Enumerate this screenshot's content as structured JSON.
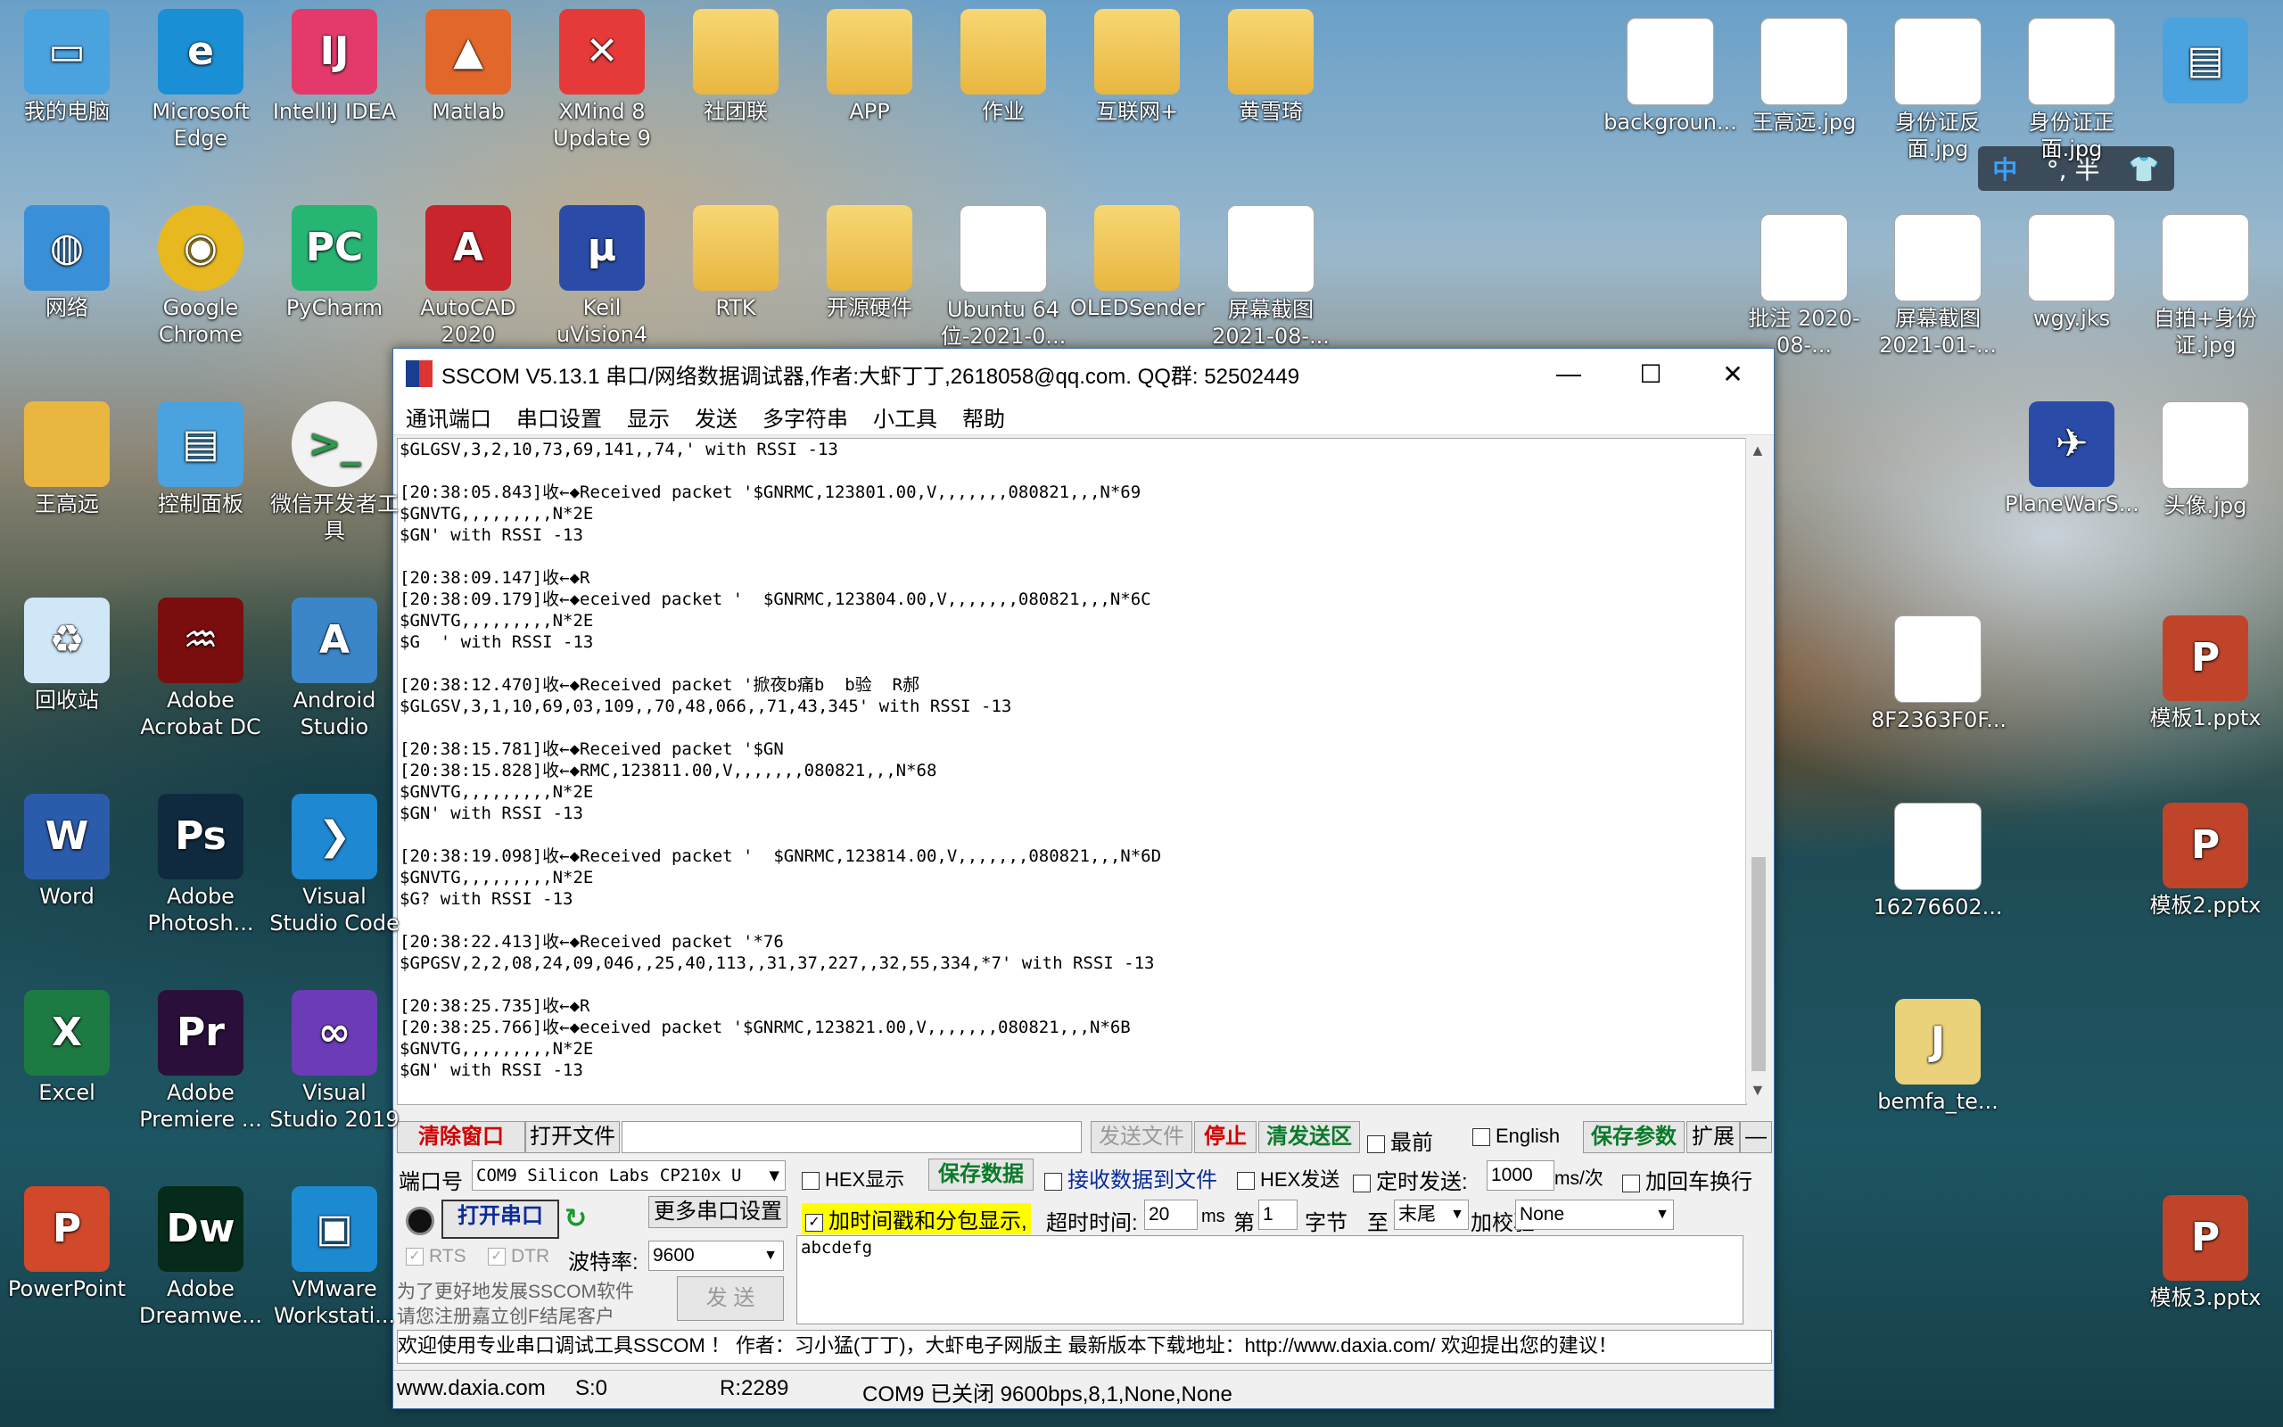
{
  "desktop_icons_left": [
    {
      "label": "我的电脑",
      "icon": "computer-icon"
    },
    {
      "label": "Microsoft Edge",
      "icon": "edge-icon"
    },
    {
      "label": "IntelliJ IDEA",
      "icon": "intellij-icon"
    },
    {
      "label": "Matlab",
      "icon": "matlab-icon"
    },
    {
      "label": "XMind 8 Update 9",
      "icon": "xmind-icon"
    },
    {
      "label": "社团联",
      "icon": "folder-icon"
    },
    {
      "label": "APP",
      "icon": "folder-icon"
    },
    {
      "label": "作业",
      "icon": "folder-icon"
    },
    {
      "label": "互联网+",
      "icon": "folder-icon"
    },
    {
      "label": "黄雪琦",
      "icon": "folder-icon"
    },
    {
      "label": "网络",
      "icon": "network-icon"
    },
    {
      "label": "Google Chrome",
      "icon": "chrome-icon"
    },
    {
      "label": "PyCharm",
      "icon": "pycharm-icon"
    },
    {
      "label": "AutoCAD 2020",
      "icon": "autocad-icon"
    },
    {
      "label": "Keil uVision4",
      "icon": "keil-icon"
    },
    {
      "label": "RTK",
      "icon": "folder-icon"
    },
    {
      "label": "开源硬件",
      "icon": "folder-icon"
    },
    {
      "label": "Ubuntu 64 位-2021-0...",
      "icon": "file-icon"
    },
    {
      "label": "OLEDSender",
      "icon": "folder-icon"
    },
    {
      "label": "屏幕截图 2021-08-...",
      "icon": "image-icon"
    },
    {
      "label": "王高远",
      "icon": "user-folder-icon"
    },
    {
      "label": "控制面板",
      "icon": "control-panel-icon"
    },
    {
      "label": "微信开发者工具",
      "icon": "wechat-dev-icon"
    },
    {
      "label": "回收站",
      "icon": "recycle-bin-icon"
    },
    {
      "label": "Adobe Acrobat DC",
      "icon": "acrobat-icon"
    },
    {
      "label": "Android Studio",
      "icon": "android-studio-icon"
    },
    {
      "label": "Word",
      "icon": "word-icon"
    },
    {
      "label": "Adobe Photosh...",
      "icon": "photoshop-icon"
    },
    {
      "label": "Visual Studio Code",
      "icon": "vscode-icon"
    },
    {
      "label": "Excel",
      "icon": "excel-icon"
    },
    {
      "label": "Adobe Premiere ...",
      "icon": "premiere-icon"
    },
    {
      "label": "Visual Studio 2019",
      "icon": "visual-studio-icon"
    },
    {
      "label": "PowerPoint",
      "icon": "powerpoint-icon"
    },
    {
      "label": "Adobe Dreamwe...",
      "icon": "dreamweaver-icon"
    },
    {
      "label": "VMware Workstati...",
      "icon": "vmware-icon"
    }
  ],
  "desktop_icons_right": [
    {
      "label": "backgroun...",
      "icon": "image-icon"
    },
    {
      "label": "王高远.jpg",
      "icon": "image-icon"
    },
    {
      "label": "身份证反面.jpg",
      "icon": "image-icon"
    },
    {
      "label": "身份证正面.jpg",
      "icon": "image-icon"
    },
    {
      "label": "",
      "icon": "control-panel-icon"
    },
    {
      "label": "批注 2020-08-...",
      "icon": "image-icon"
    },
    {
      "label": "屏幕截图 2021-01-...",
      "icon": "image-icon"
    },
    {
      "label": "wgy.jks",
      "icon": "file-icon"
    },
    {
      "label": "自拍+身份证.jpg",
      "icon": "image-icon"
    },
    {
      "label": "PlaneWarS...",
      "icon": "game-icon"
    },
    {
      "label": "头像.jpg",
      "icon": "image-icon"
    },
    {
      "label": "8F2363F0F...",
      "icon": "image-icon"
    },
    {
      "label": "模板1.pptx",
      "icon": "pptx-icon"
    },
    {
      "label": "16276602...",
      "icon": "image-icon"
    },
    {
      "label": "模板2.pptx",
      "icon": "pptx-icon"
    },
    {
      "label": "bemfa_te...",
      "icon": "archive-icon"
    },
    {
      "label": "模板3.pptx",
      "icon": "pptx-icon"
    }
  ],
  "ime": {
    "lang": "中",
    "punct": "°, 半",
    "skin": "shirt-icon"
  },
  "window": {
    "title": "SSCOM V5.13.1 串口/网络数据调试器,作者:大虾丁丁,2618058@qq.com. QQ群:  52502449",
    "minimize": "—",
    "maximize": "☐",
    "close": "✕",
    "menu": [
      "通讯端口",
      "串口设置",
      "显示",
      "发送",
      "多字符串",
      "小工具",
      "帮助"
    ]
  },
  "log_lines": [
    "$GLGSV,3,2,10,73,69,141,,74,' with RSSI -13",
    "",
    "[20:38:05.843]收←◆Received packet '$GNRMC,123801.00,V,,,,,,,080821,,,N*69",
    "$GNVTG,,,,,,,,,N*2E",
    "$GN' with RSSI -13",
    "",
    "[20:38:09.147]收←◆R",
    "[20:38:09.179]收←◆eceived packet '  $GNRMC,123804.00,V,,,,,,,080821,,,N*6C",
    "$GNVTG,,,,,,,,,N*2E",
    "$G  ' with RSSI -13",
    "",
    "[20:38:12.470]收←◆Received packet '掀夜b痛b  b验  R郝",
    "$GLGSV,3,1,10,69,03,109,,70,48,066,,71,43,345' with RSSI -13",
    "",
    "[20:38:15.781]收←◆Received packet '$GN",
    "[20:38:15.828]收←◆RMC,123811.00,V,,,,,,,080821,,,N*68",
    "$GNVTG,,,,,,,,,N*2E",
    "$GN' with RSSI -13",
    "",
    "[20:38:19.098]收←◆Received packet '  $GNRMC,123814.00,V,,,,,,,080821,,,N*6D",
    "$GNVTG,,,,,,,,,N*2E",
    "$G? with RSSI -13",
    "",
    "[20:38:22.413]收←◆Received packet '*76",
    "$GPGSV,2,2,08,24,09,046,,25,40,113,,31,37,227,,32,55,334,*7' with RSSI -13",
    "",
    "[20:38:25.735]收←◆R",
    "[20:38:25.766]收←◆eceived packet '$GNRMC,123821.00,V,,,,,,,080821,,,N*6B",
    "$GNVTG,,,,,,,,,N*2E",
    "$GN' with RSSI -13"
  ],
  "toolbar": {
    "clear": "清除窗口",
    "open_file": "打开文件",
    "send_file": "发送文件",
    "stop": "停止",
    "clear_send": "清发送区",
    "topmost": "最前",
    "english": "English",
    "save_params": "保存参数",
    "expand": "扩展",
    "collapse": "—"
  },
  "serial": {
    "port_label": "端口号",
    "port_value": "COM9 Silicon Labs CP210x U",
    "hex_display": "HEX显示",
    "save_data": "保存数据",
    "recv_to_file": "接收数据到文件",
    "hex_send": "HEX发送",
    "timed_send": "定时发送:",
    "interval": "1000",
    "interval_unit": "ms/次",
    "crlf": "加回车换行",
    "open_port": "打开串口",
    "more_settings": "更多串口设置",
    "timestamp": "加时间戳和分包显示,",
    "timeout_label": "超时时间:",
    "timeout": "20",
    "timeout_unit": "ms",
    "nth": "第",
    "nth_value": "1",
    "byte_label": "字节",
    "to": "至",
    "end": "末尾",
    "checksum_label": "加校验",
    "checksum": "None",
    "rts": "RTS",
    "dtr": "DTR",
    "baud_label": "波特率:",
    "baud": "9600",
    "send_text": "abcdefg",
    "send_button": "发 送",
    "promo": "为了更好地发展SSCOM软件\n请您注册嘉立创F结尾客户"
  },
  "ticker": "欢迎使用专业串口调试工具SSCOM ！  作者：习小猛(丁丁)，大虾电子网版主  最新版本下载地址：http://www.daxia.com/ 欢迎提出您的建议！",
  "status": {
    "site": "www.daxia.com",
    "sent": "S:0",
    "recv": "R:2289",
    "port_state": "COM9 已关闭  9600bps,8,1,None,None"
  },
  "colors": {
    "accent": "#d00000",
    "green": "#0a7a2a",
    "highlight": "#ffff00"
  }
}
